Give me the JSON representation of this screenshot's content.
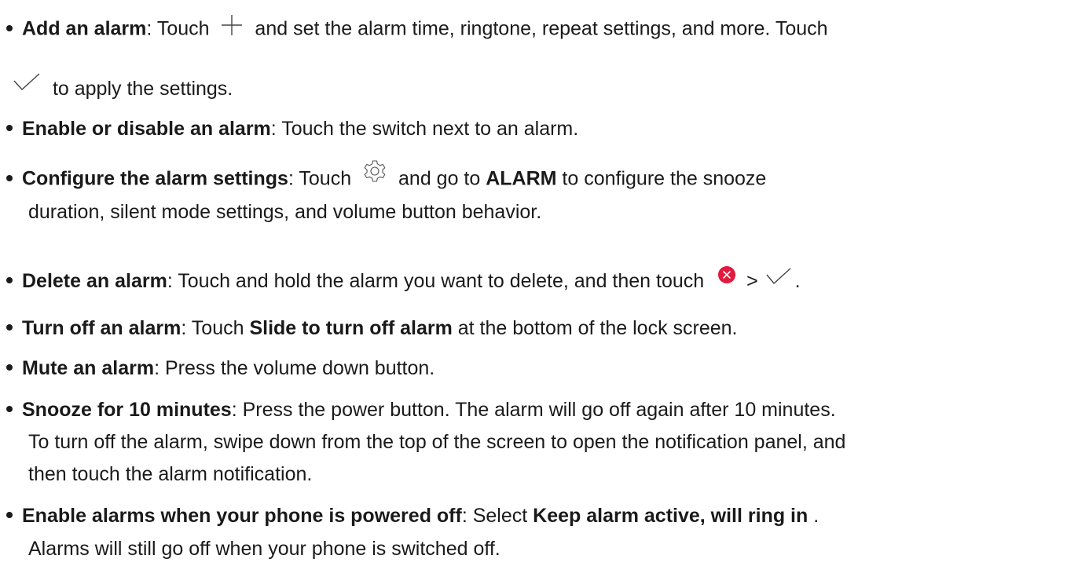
{
  "items": [
    {
      "term": "Add an alarm",
      "line1_a": ": Touch ",
      "line1_b": " and set the alarm time, ringtone, repeat settings, and more. Touch",
      "line2": " to apply the settings."
    },
    {
      "term": "Enable or disable an alarm",
      "text": ": Touch the switch next to an alarm."
    },
    {
      "term": "Configure the alarm settings",
      "line1_a": ": Touch ",
      "line1_b": " and go to ",
      "bold_mid": "ALARM",
      "line1_c": " to configure the snooze",
      "line2": "duration, silent mode settings, and volume button behavior."
    },
    {
      "term": "Delete an alarm",
      "text_a": ": Touch and hold the alarm you want to delete, and then touch ",
      "sep": " > ",
      "end": "."
    },
    {
      "term": "Turn off an alarm",
      "text_a": ": Touch ",
      "bold_mid": "Slide to turn off alarm",
      "text_b": " at the bottom of the lock screen."
    },
    {
      "term": "Mute an alarm",
      "text": ": Press the volume down button."
    },
    {
      "term": "Snooze for 10 minutes",
      "line1": ": Press the power button. The alarm will go off again after 10 minutes.",
      "line2": "To turn off the alarm, swipe down from the top of the screen to open the notification panel, and",
      "line3": "then touch the alarm notification."
    },
    {
      "term": "Enable alarms when your phone is powered off",
      "line1_a": ": Select ",
      "bold_mid": "Keep alarm active, will ring in",
      "line1_b": " .",
      "line2": "Alarms will still go off when your phone is switched off."
    }
  ],
  "icons": {
    "add": "plus-icon",
    "confirm": "check-icon",
    "settings": "gear-icon",
    "delete": "delete-x-icon",
    "delete_color": "#e3193d"
  }
}
